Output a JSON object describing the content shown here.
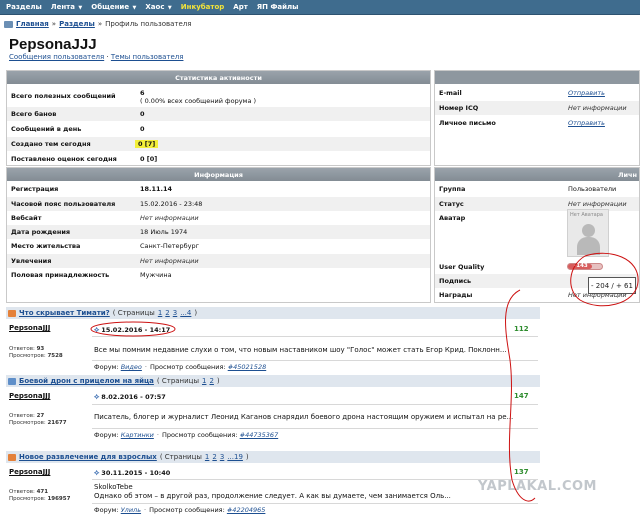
{
  "nav": {
    "items": [
      {
        "label": "Разделы",
        "caret": false,
        "highlight": false
      },
      {
        "label": "Лента",
        "caret": true,
        "highlight": false
      },
      {
        "label": "Общение",
        "caret": true,
        "highlight": false
      },
      {
        "label": "Хаос",
        "caret": true,
        "highlight": false
      },
      {
        "label": "Инкубатор",
        "caret": false,
        "highlight": true
      },
      {
        "label": "Арт",
        "caret": false,
        "highlight": false
      },
      {
        "label": "ЯП Файлы",
        "caret": false,
        "highlight": false
      }
    ],
    "caret_glyph": "▼"
  },
  "breadcrumb": {
    "home": "Главная",
    "section": "Разделы",
    "current": "Профиль пользователя",
    "sep": "»"
  },
  "profile": {
    "username": "PepsonaJJJ",
    "link_messages": "Сообщения пользователя",
    "link_topics": "Темы пользователя",
    "link_sep": "·"
  },
  "activity": {
    "header": "Статистика активности",
    "rows": [
      {
        "key": "Всего полезных сообщений",
        "value": "6",
        "note": "( 0.00% всех сообщений форума )"
      },
      {
        "key": "Всего банов",
        "value": "0"
      },
      {
        "key": "Сообщений в день",
        "value": "0"
      },
      {
        "key": "Создано тем сегодня",
        "value": "0 [7]"
      },
      {
        "key": "Поставлено оценок сегодня",
        "value": "0 [0]"
      }
    ]
  },
  "contact": {
    "rows": [
      {
        "key": "E-mail",
        "value": "Отправить"
      },
      {
        "key": "Номер ICQ",
        "value": "Нет информации"
      },
      {
        "key": "Личное письмо",
        "value": "Отправить"
      }
    ]
  },
  "info": {
    "header": "Информация",
    "rows": [
      {
        "key": "Регистрация",
        "value": "18.11.14"
      },
      {
        "key": "Часовой пояс пользователя",
        "value": "15.02.2016 - 23:48"
      },
      {
        "key": "Вебсайт",
        "value": "Нет информации"
      },
      {
        "key": "Дата рождения",
        "value": "18 Июль 1974"
      },
      {
        "key": "Место жительства",
        "value": "Санкт-Петербург"
      },
      {
        "key": "Увлечения",
        "value": "Нет информации"
      },
      {
        "key": "Половая принадлежность",
        "value": "Мужчина"
      }
    ]
  },
  "personal": {
    "header": "Личн",
    "rows": [
      {
        "key": "Группа",
        "value": "Пользователи"
      },
      {
        "key": "Статус",
        "value": "Нет информации"
      },
      {
        "key": "Аватар",
        "value": ""
      },
      {
        "key": "User Quality",
        "value": "-143"
      },
      {
        "key": "Подпись",
        "value": ""
      },
      {
        "key": "Награды",
        "value": "Нет информации"
      }
    ],
    "avatar_caption": "Нет Аватара",
    "quality_fraction": 0.7,
    "tooltip": "- 204 / + 61"
  },
  "topics": [
    {
      "title": "Что скрывает Тимати?",
      "pages_prefix": "( Страницы",
      "pages": [
        "1",
        "2",
        "3",
        "...4"
      ],
      "pages_suffix": ")",
      "icon_color": "#e4813a",
      "author": "PepsonaJJJ",
      "date": "15.02.2016 - 14:17",
      "text": "Все мы помним недавние слухи о том, что новым наставником шоу \"Голос\" может стать Егор Крид. Поклонн...",
      "count": "112",
      "replies_label": "Ответов:",
      "replies": "93",
      "views_label": "Просмотров:",
      "views": "7528",
      "forum_label": "Форум:",
      "forum": "Видео",
      "msg_label": "Просмотр сообщения:",
      "msg": "#45021528"
    },
    {
      "title": "Боевой дрон с прицелом на яйца",
      "pages_prefix": "( Страницы",
      "pages": [
        "1",
        "2"
      ],
      "pages_suffix": ")",
      "icon_color": "#5f8fc9",
      "author": "PepsonaJJJ",
      "date": "8.02.2016 - 07:57",
      "text": "Писатель, блогер и журналист Леонид Каганов снарядил боевого дрона настоящим оружием и испытал на ре...",
      "count": "147",
      "replies_label": "Ответов:",
      "replies": "27",
      "views_label": "Просмотров:",
      "views": "21677",
      "forum_label": "Форум:",
      "forum": "Картинки",
      "msg_label": "Просмотр сообщения:",
      "msg": "#44735367"
    },
    {
      "title": "Новое развлечение для взрослых",
      "pages_prefix": "( Страницы",
      "pages": [
        "1",
        "2",
        "3",
        "...19"
      ],
      "pages_suffix": ")",
      "icon_color": "#e4813a",
      "author": "PepsonaJJJ",
      "date": "30.11.2015 - 10:40",
      "text_line1": "SkolkoTebe",
      "text": "Однако об этом – в другой раз, продолжение следует. А как вы думаете, чем занимается Оль...",
      "count": "137",
      "replies_label": "Ответов:",
      "replies": "471",
      "views_label": "Просмотров:",
      "views": "196957",
      "forum_label": "Форум:",
      "forum": "Улиль",
      "msg_label": "Просмотр сообщения:",
      "msg": "#42204965"
    }
  ],
  "watermark": "YAPLAKAL.COM",
  "colors": {
    "nav_bg": "#3f6c8e",
    "annotation": "#cc1111",
    "count_green": "#2d8c2d",
    "link_blue": "#1d4f91"
  }
}
